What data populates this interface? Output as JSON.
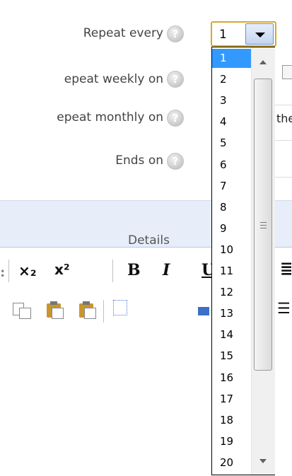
{
  "form": {
    "repeat_every_label": "Repeat every",
    "repeat_weekly_label": "epeat weekly on",
    "repeat_monthly_label": "epeat monthly on",
    "ends_on_label": "Ends on",
    "help_glyph": "?"
  },
  "select": {
    "value": "1",
    "options": [
      "1",
      "2",
      "3",
      "4",
      "5",
      "6",
      "7",
      "8",
      "9",
      "10",
      "11",
      "12",
      "13",
      "14",
      "15",
      "16",
      "17",
      "18",
      "19",
      "20"
    ],
    "selected_index": 0
  },
  "section": {
    "title": "Details"
  },
  "toolbar": {
    "subscript": "×₂",
    "superscript": "x²",
    "bold": "B",
    "italic": "I",
    "underline": "U",
    "align": "≣",
    "left_edge": ":",
    "list_glyph": "☰"
  },
  "right_side": {
    "monthly_fragment": "the"
  },
  "colors": {
    "selected_option": "#3399ff",
    "select_border": "#d7a830",
    "band": "#e7eef9"
  }
}
